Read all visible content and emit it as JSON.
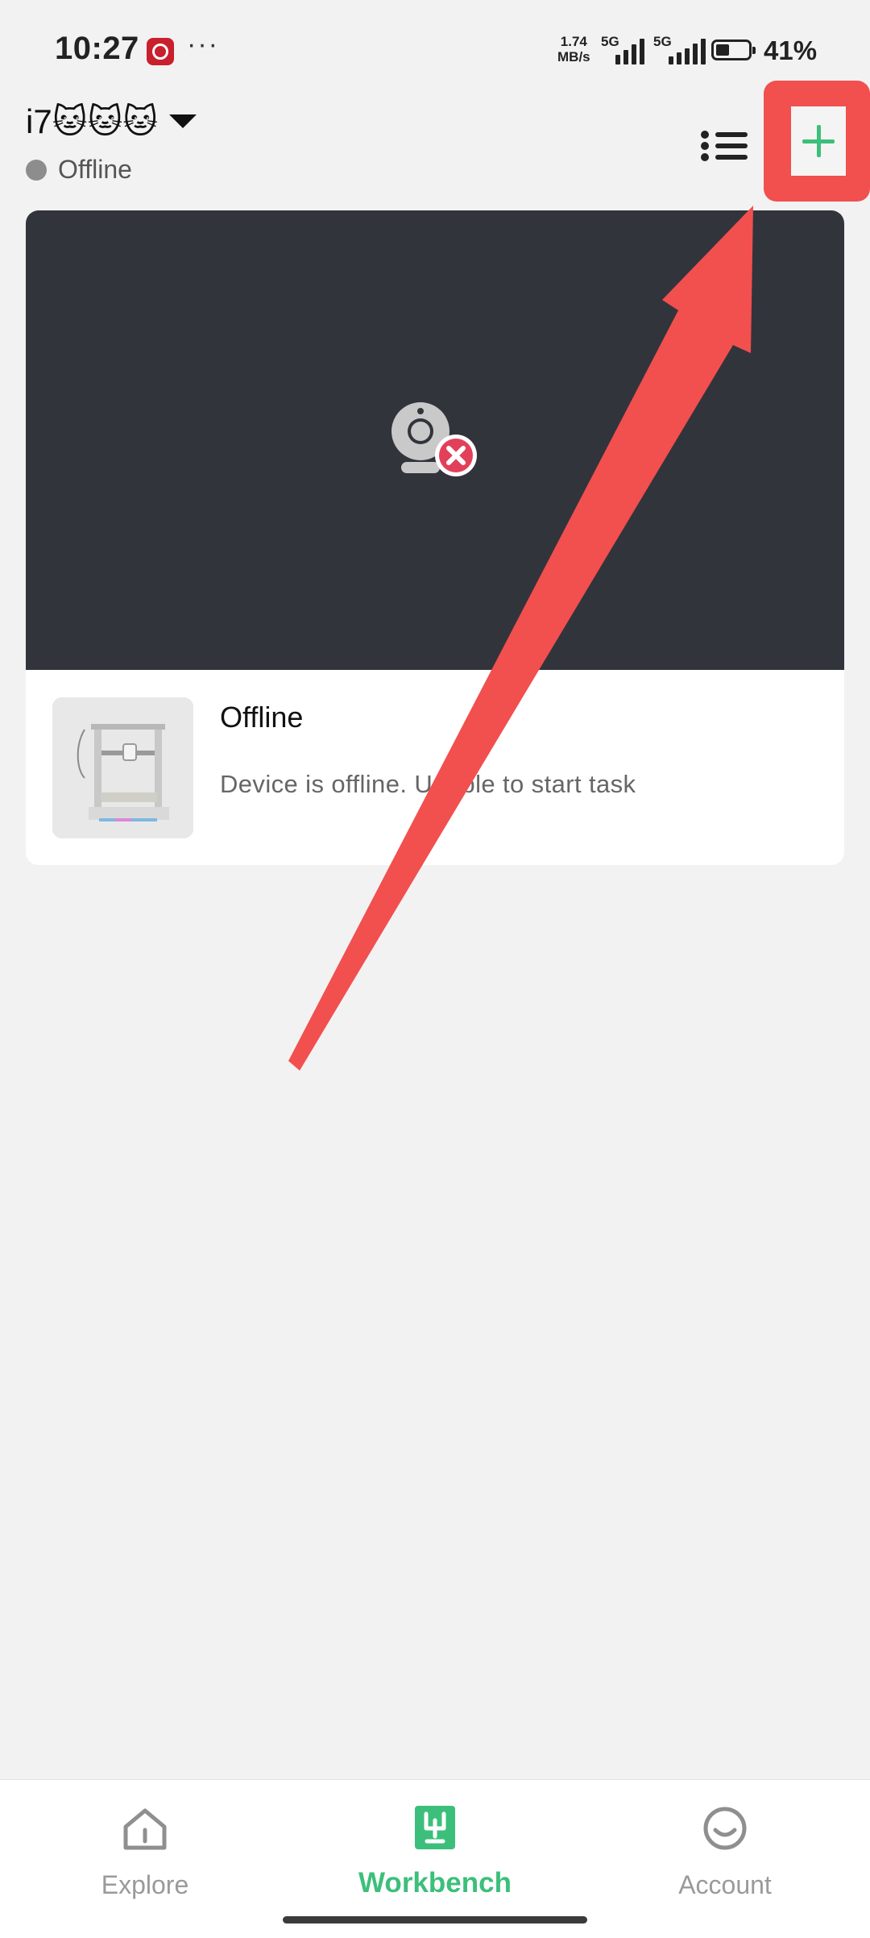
{
  "status_bar": {
    "time": "10:27",
    "more": "···",
    "speed_value": "1.74",
    "speed_unit": "MB/s",
    "sim1_label": "5G",
    "sim2_label": "5G",
    "battery_percent": "41%"
  },
  "header": {
    "device_name": "i7🐱🐱🐱",
    "connection_status": "Offline"
  },
  "device_card": {
    "title": "Offline",
    "message": "Device is offline. Unable to start task"
  },
  "bottom_nav": {
    "items": [
      {
        "label": "Explore",
        "icon": "home-icon",
        "active": false
      },
      {
        "label": "Workbench",
        "icon": "workbench-icon",
        "active": true
      },
      {
        "label": "Account",
        "icon": "account-icon",
        "active": false
      }
    ]
  },
  "colors": {
    "accent": "#3cbf7a",
    "highlight": "#f24f4f",
    "camera_bg": "#32343c",
    "offline_dot": "#8d8d8d"
  }
}
